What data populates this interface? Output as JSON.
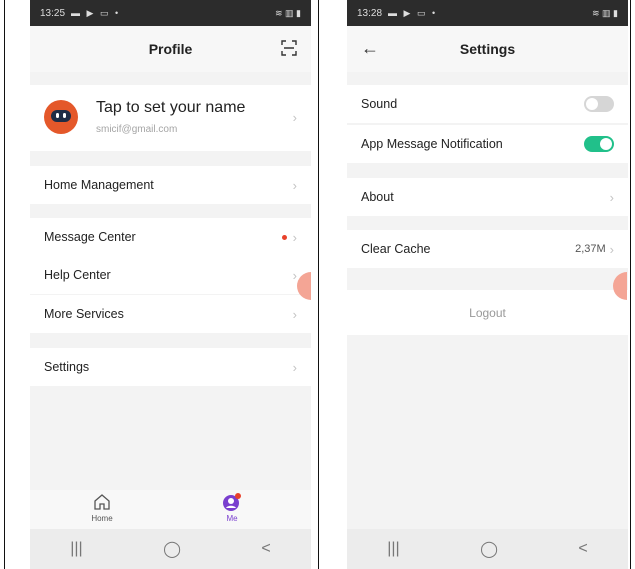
{
  "left_screen": {
    "status": {
      "time": "13:25",
      "icons": "▬ ▶ ▭ •",
      "signal": "≋ ▥ ▮"
    },
    "header": {
      "title": "Profile"
    },
    "profile": {
      "name": "Tap to set your name",
      "email": "smicif@gmail.com"
    },
    "menu": [
      {
        "label": "Home Management"
      },
      {
        "label": "Message Center"
      },
      {
        "label": "Help Center"
      },
      {
        "label": "More Services"
      },
      {
        "label": "Settings"
      }
    ],
    "bottom_nav": {
      "home": "Home",
      "me": "Me"
    }
  },
  "right_screen": {
    "status": {
      "time": "13:28",
      "icons": "▬ ▶ ▭ •",
      "signal": "≋ ▥ ▮"
    },
    "header": {
      "title": "Settings"
    },
    "items": {
      "sound": {
        "label": "Sound",
        "enabled": false
      },
      "notification": {
        "label": "App Message Notification",
        "enabled": true
      },
      "about": {
        "label": "About"
      },
      "cache": {
        "label": "Clear Cache",
        "value": "2,37M"
      }
    },
    "logout": "Logout"
  },
  "system_nav": {
    "recents": "|||",
    "home": "◯",
    "back": "<"
  },
  "colors": {
    "accent_green": "#21c08a",
    "accent_purple": "#7a3fcf",
    "avatar_orange": "#e4582a",
    "badge_red": "#e8412b"
  }
}
